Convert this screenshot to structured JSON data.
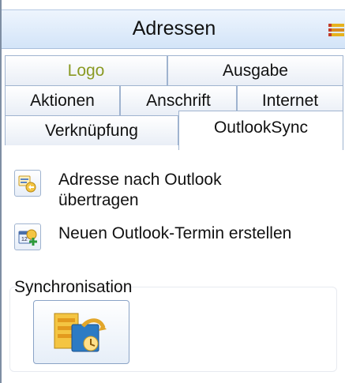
{
  "panel": {
    "title": "Adressen"
  },
  "tabs": {
    "row1": [
      "Logo",
      "Ausgabe"
    ],
    "row2": [
      "Aktionen",
      "Anschrift",
      "Internet"
    ],
    "row3": [
      "Verknüpfung",
      "OutlookSync"
    ],
    "selected": "OutlookSync"
  },
  "actions": [
    {
      "label": "Adresse nach Outlook übertragen",
      "icon": "address-to-outlook-icon"
    },
    {
      "label": "Neuen Outlook-Termin erstellen",
      "icon": "new-appointment-icon"
    }
  ],
  "sync": {
    "label": "Synchronisation",
    "icon": "outlook-sync-icon"
  }
}
